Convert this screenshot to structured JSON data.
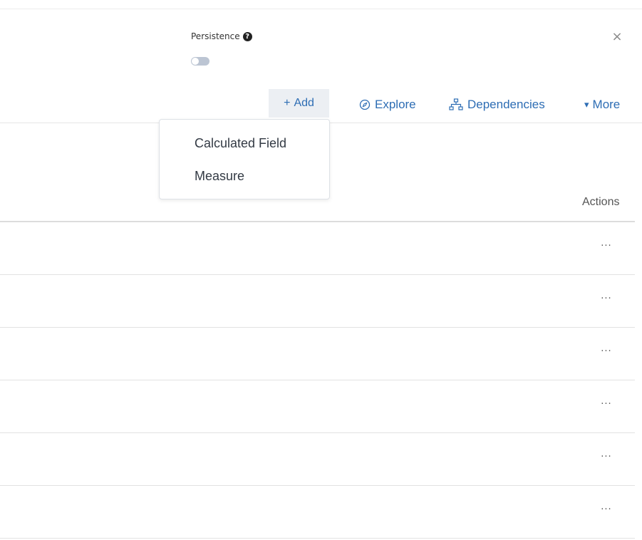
{
  "persistence": {
    "label": "Persistence",
    "help_icon": "question-circle-icon",
    "help_glyph": "?",
    "enabled": false
  },
  "close_icon": "close-icon",
  "close_glyph": "×",
  "toolbar": {
    "add_label": "Add",
    "add_glyph": "+",
    "explore_label": "Explore",
    "dependencies_label": "Dependencies",
    "more_label": "More",
    "more_glyph": "▾"
  },
  "add_menu": {
    "items": [
      {
        "label": "Calculated Field"
      },
      {
        "label": "Measure"
      }
    ]
  },
  "table": {
    "actions_header": "Actions",
    "row_action_glyph": "···",
    "rows": [
      {
        "action": "···"
      },
      {
        "action": "···"
      },
      {
        "action": "···"
      },
      {
        "action": "···"
      },
      {
        "action": "···"
      },
      {
        "action": "···"
      }
    ]
  },
  "colors": {
    "accent": "#2d6db4",
    "add_button_bg": "#eceff3",
    "toggle_off": "#bcc5d3"
  }
}
